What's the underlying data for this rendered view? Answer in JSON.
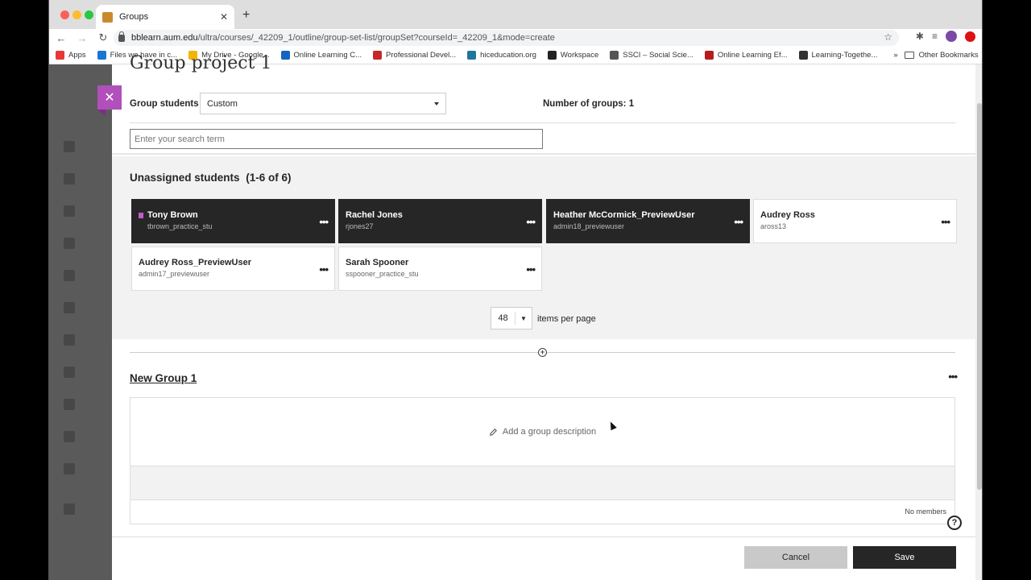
{
  "browser": {
    "tab_title": "Groups",
    "tab_close": "✕",
    "new_tab": "+",
    "url_host": "bblearn.aum.edu",
    "url_path": "/ultra/courses/_42209_1/outline/group-set-list/groupSet?courseId=_42209_1&mode=create",
    "bookmarks": [
      {
        "label": "Apps",
        "color": "#e53935"
      },
      {
        "label": "Files we have in c...",
        "color": "#1976d2"
      },
      {
        "label": "My Drive - Google...",
        "color": "#f4b400"
      },
      {
        "label": "Online Learning C...",
        "color": "#1565c0"
      },
      {
        "label": "Professional Devel...",
        "color": "#c62828"
      },
      {
        "label": "hiceducation.org",
        "color": "#21759b"
      },
      {
        "label": "Workspace",
        "color": "#222222"
      },
      {
        "label": "SSCI – Social Scie...",
        "color": "#555555"
      },
      {
        "label": "Online Learning Ef...",
        "color": "#b71c1c"
      },
      {
        "label": "Learning-Togethe...",
        "color": "#333333"
      }
    ],
    "bookmarks_more": "»",
    "other_bookmarks": "Other Bookmarks"
  },
  "page": {
    "heading_partial": "Group project 1",
    "close_icon": "✕",
    "group_students_label": "Group students",
    "group_students_value": "Custom",
    "number_of_groups": "Number of groups: 1",
    "search_placeholder": "Enter your search term",
    "unassigned_title": "Unassigned students",
    "unassigned_count": "(1-6 of 6)",
    "more_label": "•••",
    "students": [
      {
        "name": "Tony Brown",
        "user": "tbrown_practice_stu",
        "selected": true,
        "flagged": true
      },
      {
        "name": "Rachel Jones",
        "user": "rjones27",
        "selected": true,
        "flagged": false
      },
      {
        "name": "Heather McCormick_PreviewUser",
        "user": "admin18_previewuser",
        "selected": true,
        "flagged": false
      },
      {
        "name": "Audrey Ross",
        "user": "aross13",
        "selected": false,
        "flagged": false
      },
      {
        "name": "Audrey Ross_PreviewUser",
        "user": "admin17_previewuser",
        "selected": false,
        "flagged": false
      },
      {
        "name": "Sarah Spooner",
        "user": "sspooner_practice_stu",
        "selected": false,
        "flagged": false
      }
    ],
    "items_per_page_value": "48",
    "items_per_page_label": "items per page",
    "add_icon": "+",
    "group_name": "New Group 1",
    "add_description": "Add a group description",
    "no_members": "No members",
    "help_icon": "?",
    "cancel_label": "Cancel",
    "save_label": "Save"
  }
}
